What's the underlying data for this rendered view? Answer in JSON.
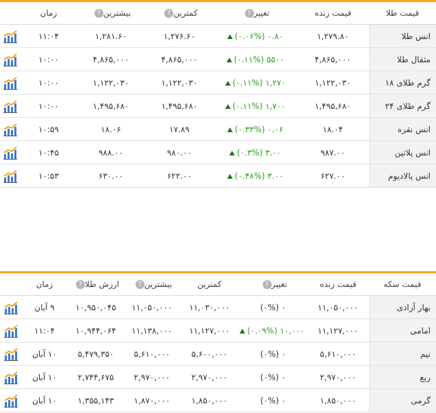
{
  "gold_table": {
    "headers": [
      "قیمت طلا",
      "قیمت زنده",
      "تغییر",
      "کمترین",
      "بیشترین",
      "زمان"
    ],
    "rows": [
      {
        "name": "انس طلا",
        "live": "۱,۲۷۹.۸۰",
        "change": "۰.۸۰ (۰.۰۶%)",
        "direction": "up",
        "low": "۱,۲۷۶.۶۰",
        "high": "۱,۲۸۱.۶۰",
        "time": "۱۱:۰۴"
      },
      {
        "name": "مثقال طلا",
        "live": "۴,۸۶۵,۰۰۰",
        "change": "۵۵۰۰ (۰.۱۱%)",
        "direction": "up",
        "low": "۴,۸۶۵,۰۰۰",
        "high": "۴,۸۶۵,۰۰۰",
        "time": "۱۰:۰۰"
      },
      {
        "name": "گرم طلای ۱۸",
        "live": "۱,۱۲۲,۰۳۰",
        "change": "۱,۲۷۰ (۰.۱۱%)",
        "direction": "up",
        "low": "۱,۱۲۲,۰۳۰",
        "high": "۱,۱۲۲,۰۳۰",
        "time": "۱۰:۰۰"
      },
      {
        "name": "گرم طلای ۲۴",
        "live": "۱,۴۹۵,۶۸۰",
        "change": "۱,۷۰۰ (۰.۱۱%)",
        "direction": "up",
        "low": "۱,۴۹۵,۶۸۰",
        "high": "۱,۴۹۵,۶۸۰",
        "time": "۱۰:۰۰"
      },
      {
        "name": "انس نقره",
        "live": "۱۸.۰۴",
        "change": "۰.۰۶ (۰.۳۳%)",
        "direction": "up",
        "low": "۱۷.۸۹",
        "high": "۱۸.۰۶",
        "time": "۱۰:۵۹"
      },
      {
        "name": "انس پلاتین",
        "live": "۹۸۷.۰۰",
        "change": "۳.۰۰ (۰.۳%)",
        "direction": "up",
        "low": "۹۸۰.۰۰",
        "high": "۹۸۸.۰۰",
        "time": "۱۰:۴۵"
      },
      {
        "name": "انس پالادیوم",
        "live": "۶۲۷.۰۰",
        "change": "۳.۰۰ (۰.۴۸%)",
        "direction": "up",
        "low": "۶۲۲.۰۰",
        "high": "۶۳۰.۰۰",
        "time": "۱۰:۵۳"
      }
    ]
  },
  "coin_table": {
    "headers": [
      "قیمت سکه",
      "قیمت زنده",
      "تغییر",
      "کمترین",
      "بیشترین",
      "ارزش طلا",
      "زمان"
    ],
    "rows": [
      {
        "name": "بهار آزادی",
        "live": "۱۱,۰۵۰,۰۰۰",
        "change": "۰ (۰%)",
        "direction": "flat",
        "low": "۱۱,۰۳۰,۰۰۰",
        "high": "۱۱,۰۵۰,۰۰۰",
        "gold_value": "۱۰,۹۵۰,۰۴۵",
        "time": "۹ آبان"
      },
      {
        "name": "امامی",
        "live": "۱۱,۱۲۷,۰۰۰",
        "change": "۱۰,۰۰۰ (۰.۰۹%)",
        "direction": "up",
        "low": "۱۱,۱۲۷,۰۰۰",
        "high": "۱۱,۱۳۸,۰۰۰",
        "gold_value": "۱۰,۹۴۴,۰۶۴",
        "time": "۱۱:۰۴"
      },
      {
        "name": "نیم",
        "live": "۵,۶۱۰,۰۰۰",
        "change": "۰ (۰%)",
        "direction": "flat",
        "low": "۵,۶۰۰,۰۰۰",
        "high": "۵,۶۱۰,۰۰۰",
        "gold_value": "۵,۴۷۹,۳۵۰",
        "time": "۱۰ آبان"
      },
      {
        "name": "ربع",
        "live": "۲,۹۷۰,۰۰۰",
        "change": "۰ (۰%)",
        "direction": "flat",
        "low": "۲,۹۷۰,۰۰۰",
        "high": "۲,۹۷۰,۰۰۰",
        "gold_value": "۲,۷۴۴,۶۷۵",
        "time": "۱۰ آبان"
      },
      {
        "name": "گرمی",
        "live": "۱,۸۵۰,۰۰۰",
        "change": "۰ (۰%)",
        "direction": "flat",
        "low": "۱,۸۵۰,۰۰۰",
        "high": "۱,۸۷۰,۰۰۰",
        "gold_value": "۱,۳۵۵,۱۴۳",
        "time": "۱۰ آبان"
      }
    ]
  },
  "icons": {
    "help": "help-icon",
    "chart": "chart-icon",
    "up": "up-triangle-icon"
  },
  "colors": {
    "accent": "#f5a31a",
    "positive": "#2a9d1e",
    "name_bg": "#f2f2f2"
  }
}
